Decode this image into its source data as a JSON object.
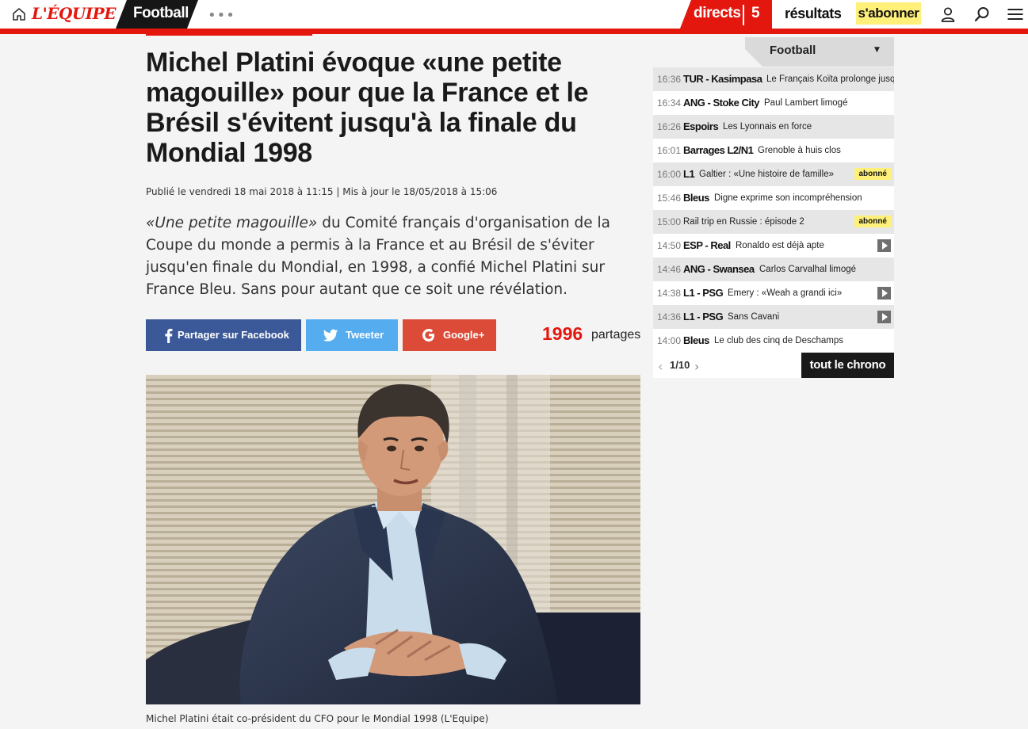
{
  "nav": {
    "logo": "L'ÉQUIPE",
    "section": "Football",
    "more": "•••",
    "directs": "directs",
    "directs_count": "5",
    "resultats": "résultats",
    "subscribe": "s'abonner",
    "icons": [
      "home-icon",
      "user-icon",
      "search-icon",
      "menu-icon"
    ]
  },
  "article": {
    "headline": "Michel Platini évoque «une petite magouille» pour que la France et le Brésil s'évitent jusqu'à la finale du Mondial 1998",
    "published": "Publié le vendredi 18 mai 2018 à 11:15 | Mis à jour le 18/05/2018 à 15:06",
    "lead_quote": "«Une petite magouille»",
    "lead_rest": " du Comité français d'organisation de la Coupe du monde a permis à la France et au Brésil de s'éviter jusqu'en finale du Mondial, en 1998, a confié Michel Platini sur France Bleu. Sans pour autant que ce soit une révélation.",
    "share": {
      "facebook": "Partager sur Facebook",
      "twitter": "Tweeter",
      "google": "Google+",
      "count": "1996",
      "count_unit": "partages"
    },
    "caption": "Michel Platini était co-président du CFO pour le Mondial 1998 (L'Equipe)"
  },
  "feed": {
    "title": "Football",
    "items": [
      {
        "time": "16:36",
        "category": "TUR - Kasimpasa",
        "headline": "Le Français Koïta prolonge jusq...",
        "badge": "",
        "video": false
      },
      {
        "time": "16:34",
        "category": "ANG - Stoke City",
        "headline": "Paul Lambert limogé",
        "badge": "",
        "video": false
      },
      {
        "time": "16:26",
        "category": "Espoirs",
        "headline": "Les Lyonnais en force",
        "badge": "",
        "video": false
      },
      {
        "time": "16:01",
        "category": "Barrages L2/N1",
        "headline": "Grenoble à huis clos",
        "badge": "",
        "video": false
      },
      {
        "time": "16:00",
        "category": "L1",
        "headline": "Galtier : «Une histoire de famille»",
        "badge": "abonné",
        "video": false
      },
      {
        "time": "15:46",
        "category": "Bleus",
        "headline": "Digne exprime son incompréhension",
        "badge": "",
        "video": false
      },
      {
        "time": "15:00",
        "category": "",
        "headline": "Rail trip en Russie : épisode 2",
        "badge": "abonné",
        "video": false
      },
      {
        "time": "14:50",
        "category": "ESP - Real",
        "headline": "Ronaldo est déjà apte",
        "badge": "",
        "video": true
      },
      {
        "time": "14:46",
        "category": "ANG - Swansea",
        "headline": "Carlos Carvalhal limogé",
        "badge": "",
        "video": false
      },
      {
        "time": "14:38",
        "category": "L1 - PSG",
        "headline": "Emery : «Weah a grandi ici»",
        "badge": "",
        "video": true
      },
      {
        "time": "14:36",
        "category": "L1 - PSG",
        "headline": "Sans Cavani",
        "badge": "",
        "video": true
      },
      {
        "time": "14:00",
        "category": "Bleus",
        "headline": "Le club des cinq de Deschamps",
        "badge": "",
        "video": false
      }
    ],
    "pager": "1/10",
    "all_button": "tout le chrono"
  },
  "colors": {
    "brand_red": "#e4170f",
    "subscribe_yellow": "#fff07a",
    "facebook": "#3b5998",
    "twitter": "#55acee",
    "google": "#dc4a38"
  }
}
